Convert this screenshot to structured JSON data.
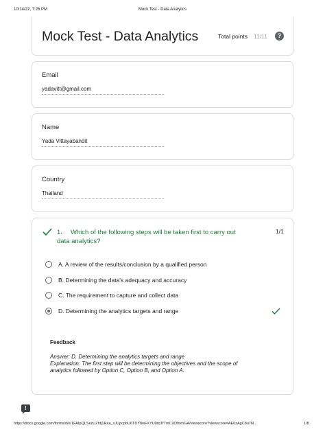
{
  "print_header": {
    "datetime": "10/14/22, 7:26 PM",
    "title": "Mock Test - Data Analytics"
  },
  "form": {
    "title": "Mock Test - Data Analytics",
    "total_points_label": "Total points",
    "total_points_value": "11/11",
    "help_icon": "?"
  },
  "fields": {
    "email": {
      "label": "Email",
      "value": "yadavitt@gmail.com"
    },
    "name": {
      "label": "Name",
      "value": "Yada Vittayabandit"
    },
    "country": {
      "label": "Country",
      "value": "Thailand"
    }
  },
  "question": {
    "number": "1.",
    "text": "Which of the following steps will be taken first to carry out data analytics?",
    "score": "1/1",
    "options": [
      {
        "label": "A. A review of the results/conclusion by a qualified person",
        "selected": false
      },
      {
        "label": "B. Determining the data's adequacy and accuracy",
        "selected": false
      },
      {
        "label": "C. The requirement to capture and collect data",
        "selected": false
      },
      {
        "label": "D. Determining the analytics targets and range",
        "selected": true,
        "correct": true
      }
    ],
    "feedback_title": "Feedback",
    "feedback_text": "Answer: D. Determining the analytics targets and range\nExplanation: The first step will be determining the objectives and the scope of analytics followed by Option C, Option B, and Option A."
  },
  "colors": {
    "correct_green": "#188038",
    "radio_gray": "#5f6368",
    "border": "#dadce0"
  },
  "icons": {
    "report": "report-problem-icon",
    "check": "check-icon"
  },
  "print_footer": {
    "url": "https://docs.google.com/forms/d/e/1FAIpQLSezUZhtj1Raa_xJUpcpbU6TDY8wFXYU0rqTfTmCXDfxxhGA/viewscore?viewscore=AE0zAgC8u76l...",
    "page": "1/8"
  }
}
